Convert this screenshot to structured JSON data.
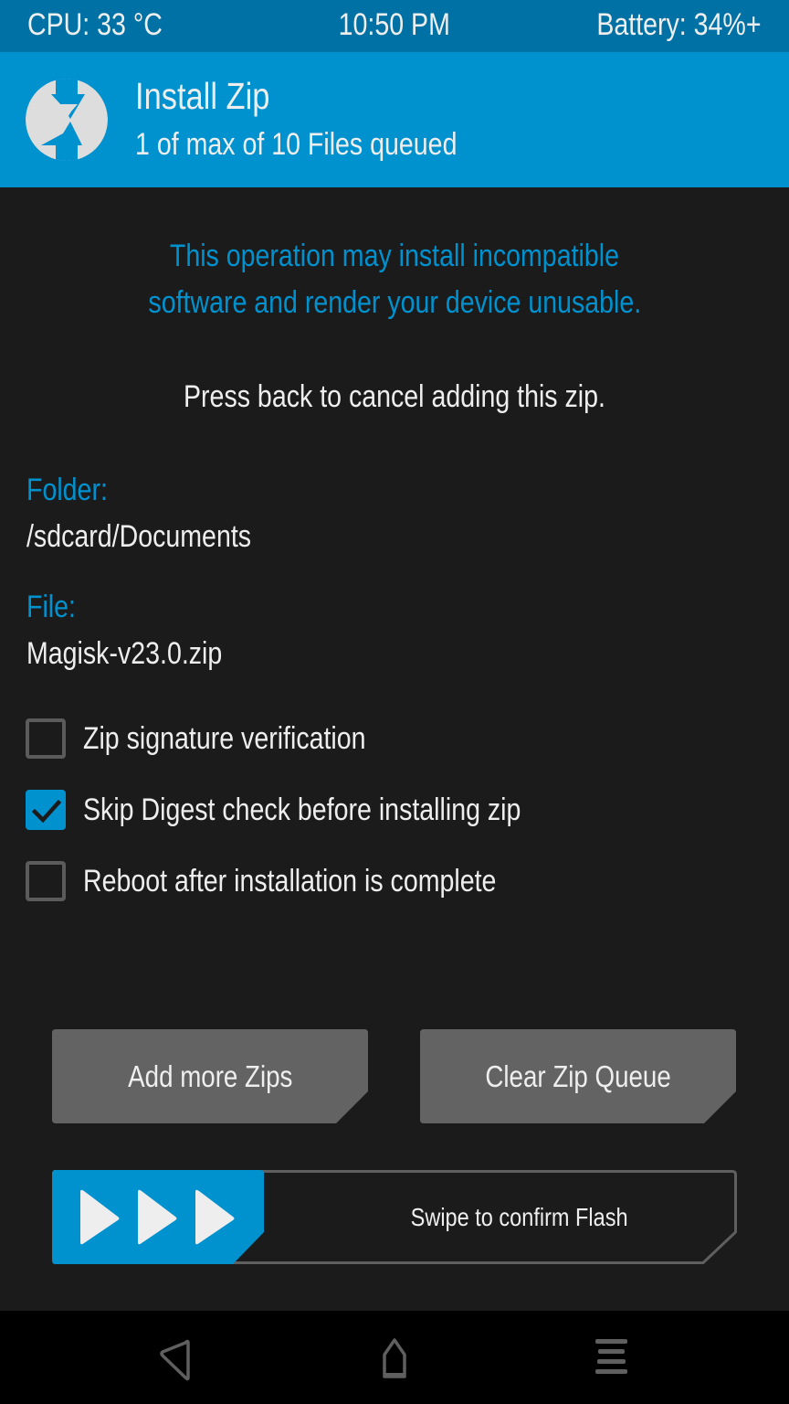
{
  "status_bar": {
    "cpu": "CPU: 33 °C",
    "time": "10:50 PM",
    "battery": "Battery: 34%+"
  },
  "header": {
    "logo_icon": "twrp-logo-icon",
    "title": "Install Zip",
    "subtitle": "1 of max of 10 Files queued"
  },
  "warning": {
    "line1": "This operation may install incompatible",
    "line2": "software and render your device unusable."
  },
  "instruction": "Press back to cancel adding this zip.",
  "folder": {
    "label": "Folder:",
    "value": "/sdcard/Documents"
  },
  "file": {
    "label": "File:",
    "value": "Magisk-v23.0.zip"
  },
  "options": [
    {
      "label": "Zip signature verification",
      "checked": false
    },
    {
      "label": "Skip Digest check before installing zip",
      "checked": true
    },
    {
      "label": "Reboot after installation is complete",
      "checked": false
    }
  ],
  "buttons": {
    "add_more": "Add more Zips",
    "clear_queue": "Clear Zip Queue"
  },
  "swipe": {
    "label": "Swipe to confirm Flash",
    "handle_icon": "triple-arrow-right-icon"
  },
  "navbar": {
    "back_icon": "back-triangle-icon",
    "home_icon": "home-icon",
    "menu_icon": "menu-lines-icon"
  },
  "colors": {
    "accent": "#0091cf",
    "status_bar": "#0071a4",
    "background": "#1b1b1b",
    "button": "#636363",
    "text": "#eeeeee",
    "nav_icon": "#5f5f5f"
  }
}
